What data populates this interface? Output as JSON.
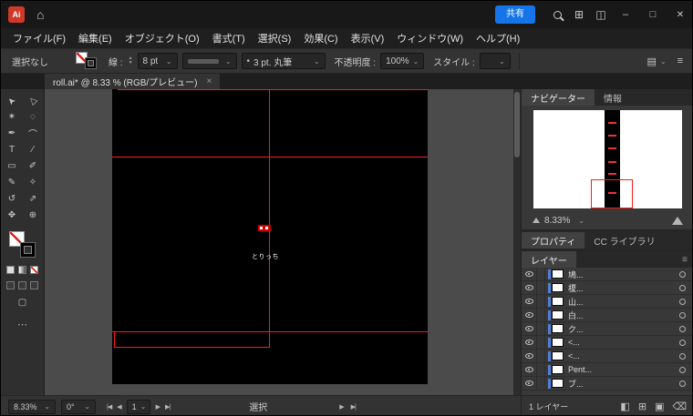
{
  "titlebar": {
    "app_badge": "Ai",
    "share_label": "共有",
    "minimize_glyph": "–",
    "maximize_glyph": "□",
    "close_glyph": "✕"
  },
  "menubar": {
    "items": [
      "ファイル(F)",
      "編集(E)",
      "オブジェクト(O)",
      "書式(T)",
      "選択(S)",
      "効果(C)",
      "表示(V)",
      "ウィンドウ(W)",
      "ヘルプ(H)"
    ]
  },
  "control_bar": {
    "selection_status": "選択なし",
    "stroke_label": "線 :",
    "stroke_width": "8 pt",
    "brush_name": "3 pt. 丸筆",
    "opacity_label": "不透明度 :",
    "opacity_value": "100%",
    "style_label": "スタイル :"
  },
  "document": {
    "tab_title": "roll.ai* @ 8.33 % (RGB/プレビュー)",
    "close_glyph": "×"
  },
  "tools": {
    "items": [
      {
        "name": "selection",
        "glyph": "➤"
      },
      {
        "name": "direct-selection",
        "glyph": "▷"
      },
      {
        "name": "magic-wand",
        "glyph": "✶"
      },
      {
        "name": "lasso",
        "glyph": "◌"
      },
      {
        "name": "pen",
        "glyph": "✒"
      },
      {
        "name": "curvature",
        "glyph": "⌒"
      },
      {
        "name": "type",
        "glyph": "T"
      },
      {
        "name": "line-segment",
        "glyph": "∕"
      },
      {
        "name": "rectangle",
        "glyph": "▭"
      },
      {
        "name": "paintbrush",
        "glyph": "✐"
      },
      {
        "name": "pencil",
        "glyph": "✎"
      },
      {
        "name": "shaper",
        "glyph": "✧"
      },
      {
        "name": "rotate",
        "glyph": "↺"
      },
      {
        "name": "scale",
        "glyph": "⇗"
      },
      {
        "name": "hand",
        "glyph": "✥"
      },
      {
        "name": "zoom",
        "glyph": "⊕"
      }
    ]
  },
  "canvas": {
    "artboard_label": "とりっち"
  },
  "navigator": {
    "tab_navigator": "ナビゲーター",
    "tab_info": "情報",
    "zoom_value": "8.33%"
  },
  "properties": {
    "tab_properties": "プロパティ",
    "tab_cc_libraries": "CC ライブラリ"
  },
  "layers_panel": {
    "tab": "レイヤー",
    "rows": [
      {
        "name": "鳩..."
      },
      {
        "name": "榎..."
      },
      {
        "name": "山..."
      },
      {
        "name": "白..."
      },
      {
        "name": "ク..."
      },
      {
        "name": "<..."
      },
      {
        "name": "<..."
      },
      {
        "name": "Pent..."
      },
      {
        "name": "ブ..."
      }
    ],
    "footer_count": "1 レイヤー"
  },
  "status_bar": {
    "zoom": "8.33%",
    "rotation": "0°",
    "artboard_number": "1",
    "tool_name": "選択"
  },
  "colors": {
    "accent_blue": "#1574e8",
    "artwork_red": "#ff1a1a",
    "layer_color_blue": "#4f7edb",
    "app_badge_red": "#cf3a28"
  }
}
